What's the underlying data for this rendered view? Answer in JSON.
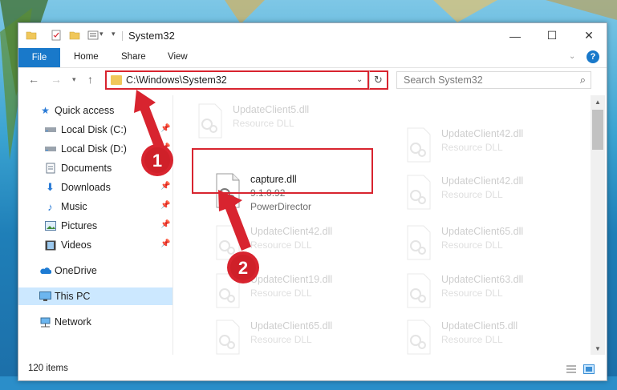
{
  "window": {
    "title": "System32",
    "minimize": "—",
    "maximize": "☐",
    "close": "✕"
  },
  "ribbon": {
    "file": "File",
    "home": "Home",
    "share": "Share",
    "view": "View",
    "help": "?"
  },
  "address_bar": {
    "path": "C:\\Windows\\System32"
  },
  "search": {
    "placeholder": "Search System32"
  },
  "sidebar": {
    "items": [
      {
        "label": "Quick access",
        "icon": "star-icon"
      },
      {
        "label": "Local Disk (C:)",
        "icon": "drive-icon",
        "pinned": true
      },
      {
        "label": "Local Disk (D:)",
        "icon": "drive-icon",
        "pinned": true
      },
      {
        "label": "Documents",
        "icon": "documents-icon",
        "pinned": true
      },
      {
        "label": "Downloads",
        "icon": "downloads-icon",
        "pinned": true
      },
      {
        "label": "Music",
        "icon": "music-icon",
        "pinned": true
      },
      {
        "label": "Pictures",
        "icon": "pictures-icon",
        "pinned": true
      },
      {
        "label": "Videos",
        "icon": "videos-icon",
        "pinned": true
      },
      {
        "label": "OneDrive",
        "icon": "onedrive-icon"
      },
      {
        "label": "This PC",
        "icon": "computer-icon",
        "selected": true
      },
      {
        "label": "Network",
        "icon": "network-icon"
      }
    ]
  },
  "files": {
    "left": [
      {
        "name": "UpdateClient5.dll",
        "sub": "Resource DLL"
      },
      {
        "name": "capture.dll",
        "version": "9.1.0.92",
        "sub": "PowerDirector"
      },
      {
        "name": "UpdateClient42.dll",
        "sub": "Resource DLL"
      },
      {
        "name": "UpdateClient19.dll",
        "sub": "Resource DLL"
      },
      {
        "name": "UpdateClient65.dll",
        "sub": "Resource DLL"
      }
    ],
    "right": [
      {
        "name": "UpdateClient42.dll",
        "sub": "Resource DLL"
      },
      {
        "name": "UpdateClient42.dll",
        "sub": "Resource DLL"
      },
      {
        "name": "UpdateClient65.dll",
        "sub": "Resource DLL"
      },
      {
        "name": "UpdateClient63.dll",
        "sub": "Resource DLL"
      },
      {
        "name": "UpdateClient5.dll",
        "sub": "Resource DLL"
      }
    ]
  },
  "status": {
    "count": "120 items"
  },
  "annotations": {
    "step1": "1",
    "step2": "2",
    "color": "#d8242f"
  }
}
